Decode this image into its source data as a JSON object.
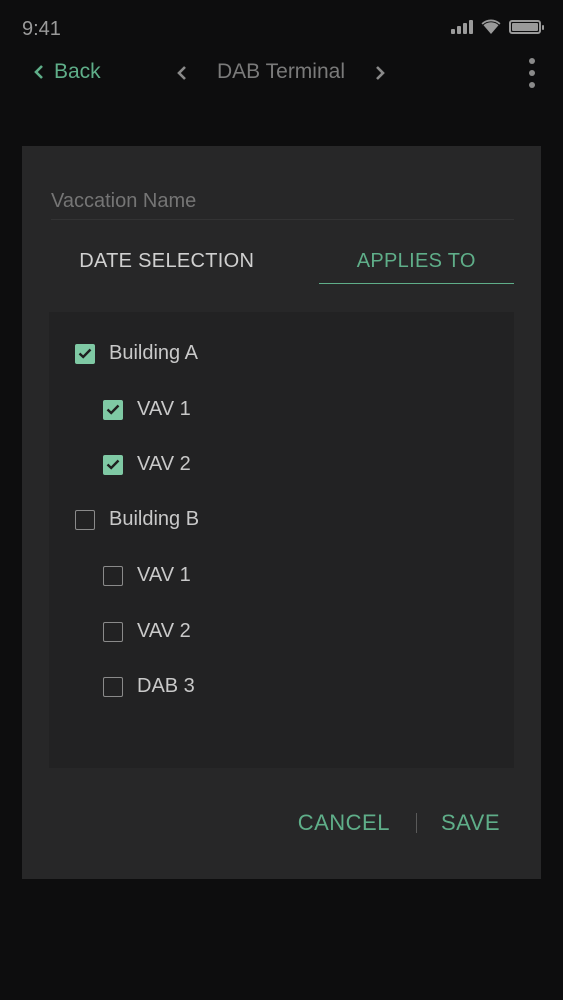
{
  "status_bar": {
    "time": "9:41",
    "icons": [
      "signal-icon",
      "wifi-icon",
      "battery-icon"
    ]
  },
  "nav": {
    "back_label": "Back",
    "title": "DAB Terminal"
  },
  "dialog": {
    "name_placeholder": "Vaccation Name",
    "tabs": [
      {
        "label": "DATE SELECTION",
        "active": false
      },
      {
        "label": "APPLIES TO",
        "active": true
      }
    ],
    "tree": [
      {
        "label": "Building A",
        "level": 0,
        "checked": true
      },
      {
        "label": "VAV 1",
        "level": 1,
        "checked": true
      },
      {
        "label": "VAV 2",
        "level": 1,
        "checked": true
      },
      {
        "label": "Building B",
        "level": 0,
        "checked": false
      },
      {
        "label": "VAV 1",
        "level": 1,
        "checked": false
      },
      {
        "label": "VAV 2",
        "level": 1,
        "checked": false
      },
      {
        "label": "DAB 3",
        "level": 1,
        "checked": false
      }
    ],
    "cancel_label": "CANCEL",
    "save_label": "SAVE"
  },
  "colors": {
    "accent": "#5fae89",
    "checkbox_fill": "#7fc9a4",
    "background": "#0d0d0e",
    "card": "#272728"
  }
}
